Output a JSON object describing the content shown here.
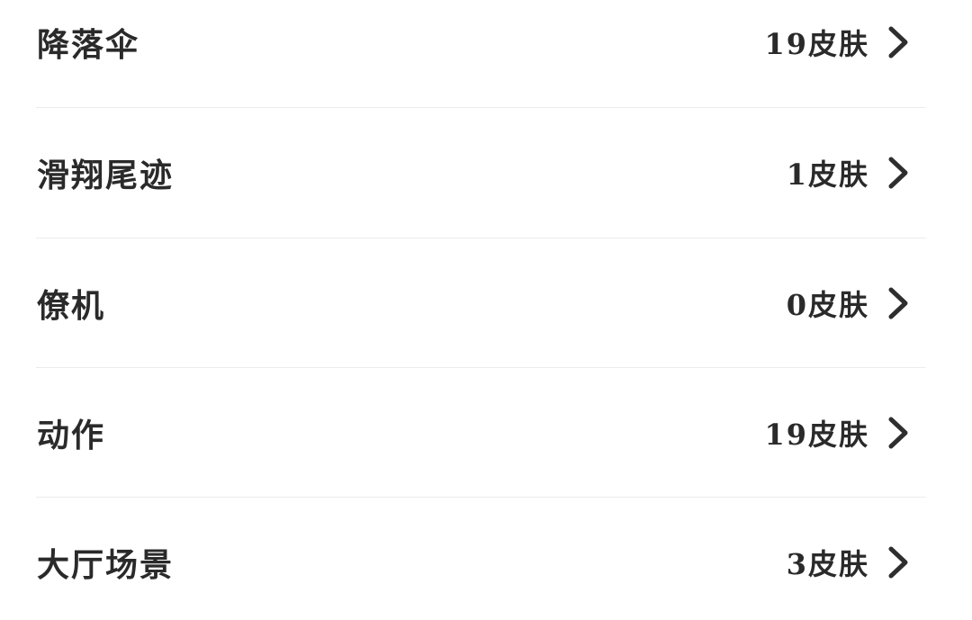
{
  "skin_categories": [
    {
      "label": "降落伞",
      "count": "19皮肤",
      "icon": "chevron-right-icon"
    },
    {
      "label": "滑翔尾迹",
      "count": "1皮肤",
      "icon": "chevron-right-icon"
    },
    {
      "label": "僚机",
      "count": "0皮肤",
      "icon": "chevron-right-icon"
    },
    {
      "label": "动作",
      "count": "19皮肤",
      "icon": "chevron-right-icon"
    },
    {
      "label": "大厅场景",
      "count": "3皮肤",
      "icon": "chevron-right-icon"
    }
  ]
}
